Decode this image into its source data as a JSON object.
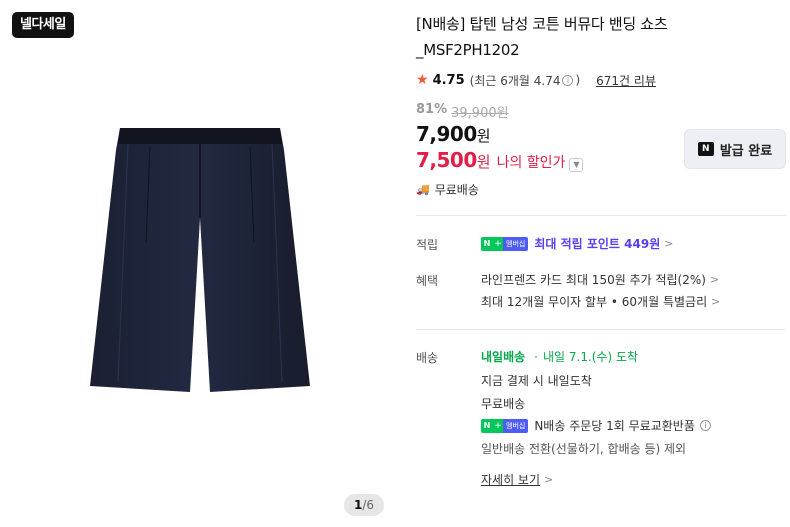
{
  "badge": "넬다세일",
  "pager": {
    "current": "1",
    "separator": "/",
    "total": "6"
  },
  "product": {
    "title": "[N배송] 탑텐 남성 코튼 버뮤다 밴딩 쇼츠 _MSF2PH1202",
    "rating": "4.75",
    "recent_rating_prefix": "(최근 6개월 4.74",
    "recent_rating_suffix": ")",
    "review_count": "671건 리뷰",
    "discount_rate": "81%",
    "original_price": "39,900원",
    "sale_price": "7,900",
    "sale_price_unit": "원",
    "my_price": "7,500",
    "my_price_unit": "원",
    "my_price_label": "나의 할인가",
    "shipping_fee": "무료배송"
  },
  "coupon_button": {
    "label": "발급 완료",
    "icon_text": "N"
  },
  "sections": {
    "reward": {
      "label": "적립",
      "badge_n": "N",
      "badge_plus": "+",
      "badge_membership": "멤버십",
      "text": "최대 적립 포인트 449원"
    },
    "benefit": {
      "label": "혜택",
      "line1": "라인프렌즈 카드 최대 150원 추가 적립(2%)",
      "line2": "최대 12개월 무이자 할부 • 60개월 특별금리"
    },
    "delivery": {
      "label": "배송",
      "brand": "내일배송",
      "separator": "·",
      "eta": "내일 7.1.(수) 도착",
      "line2": "지금 결제 시 내일도착",
      "line3": "무료배송",
      "line4": "N배송 주문당 1회 무료교환반품",
      "line5": "일반배송 전환(선물하기, 합배송 등) 제외",
      "more": "자세히 보기"
    }
  },
  "colors": {
    "accent_red": "#e11d48",
    "naver_green": "#03c75a",
    "membership_purple": "#5b3df5",
    "star": "#f15a35"
  }
}
